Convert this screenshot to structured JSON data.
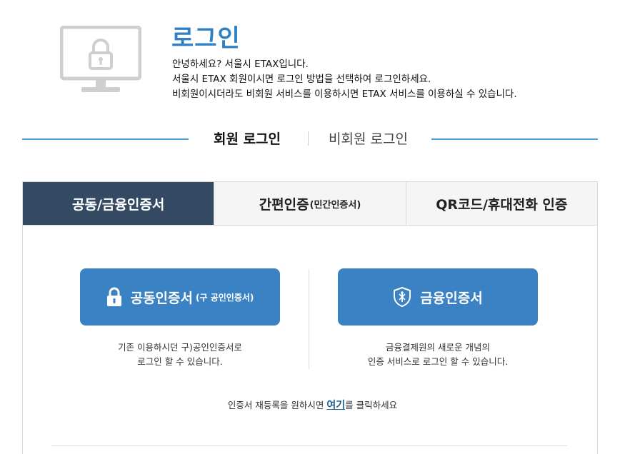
{
  "header": {
    "title": "로그인",
    "intro_lines": [
      "안녕하세요? 서울시 ETAX입니다.",
      "서울시 ETAX 회원이시면 로그인 방법을 선택하여 로그인하세요.",
      "비회원이시더라도 비회원 서비스를 이용하시면 ETAX 서비스를 이용하실 수 있습니다."
    ]
  },
  "login_switch": {
    "member": "회원 로그인",
    "guest": "비회원 로그인"
  },
  "tabs": [
    {
      "label": "공동/금융인증서",
      "sub": ""
    },
    {
      "label": "간편인증",
      "sub": "(민간인증서)"
    },
    {
      "label": "QR코드/휴대전화 인증",
      "sub": ""
    }
  ],
  "certs": {
    "joint": {
      "label": "공동인증서",
      "sub": "(구 공인인증서)",
      "desc_lines": [
        "기존 이용하시던 구)공인인증서로",
        "로그인 할 수 있습니다."
      ]
    },
    "finance": {
      "label": "금융인증서",
      "desc_lines": [
        "금융결제원의 새로운 개념의",
        "인증 서비스로 로그인 할 수 있습니다."
      ]
    }
  },
  "reregister": {
    "before": "인증서 재등록을 원하시면 ",
    "link": "여기",
    "after": "를 클릭하세요"
  },
  "colors": {
    "accent": "#2f80c5",
    "button": "#3a82c4",
    "active_tab": "#344a63"
  }
}
